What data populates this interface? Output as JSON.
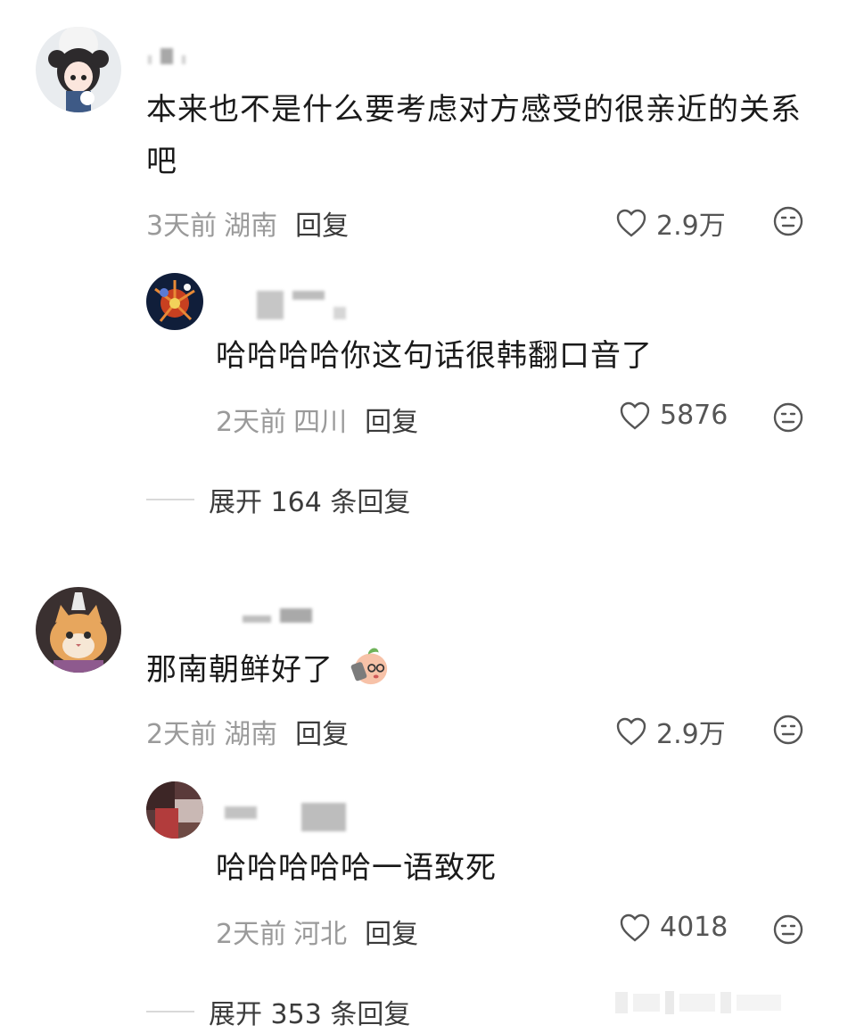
{
  "comments": [
    {
      "text": "本来也不是什么要考虑对方感受的很亲近的关系吧",
      "time": "3天前",
      "location": "湖南",
      "reply_label": "回复",
      "likes": "2.9万",
      "replies": [
        {
          "text": "哈哈哈哈你这句话很韩翻口音了",
          "time": "2天前",
          "location": "四川",
          "reply_label": "回复",
          "likes": "5876"
        }
      ],
      "expand_label": "展开 164 条回复"
    },
    {
      "text": "那南朝鲜好了",
      "time": "2天前",
      "location": "湖南",
      "reply_label": "回复",
      "likes": "2.9万",
      "replies": [
        {
          "text": "哈哈哈哈哈一语致死",
          "time": "2天前",
          "location": "河北",
          "reply_label": "回复",
          "likes": "4018"
        }
      ],
      "expand_label": "展开 353 条回复"
    }
  ],
  "icons": {
    "like": "heart-outline-icon",
    "emoji": "neutral-face-icon",
    "sticker": "peach-holding-phone-sticker"
  },
  "colors": {
    "text_primary": "#1a1a1a",
    "text_meta": "#9a9a9a",
    "text_action": "#3a3a3a"
  }
}
